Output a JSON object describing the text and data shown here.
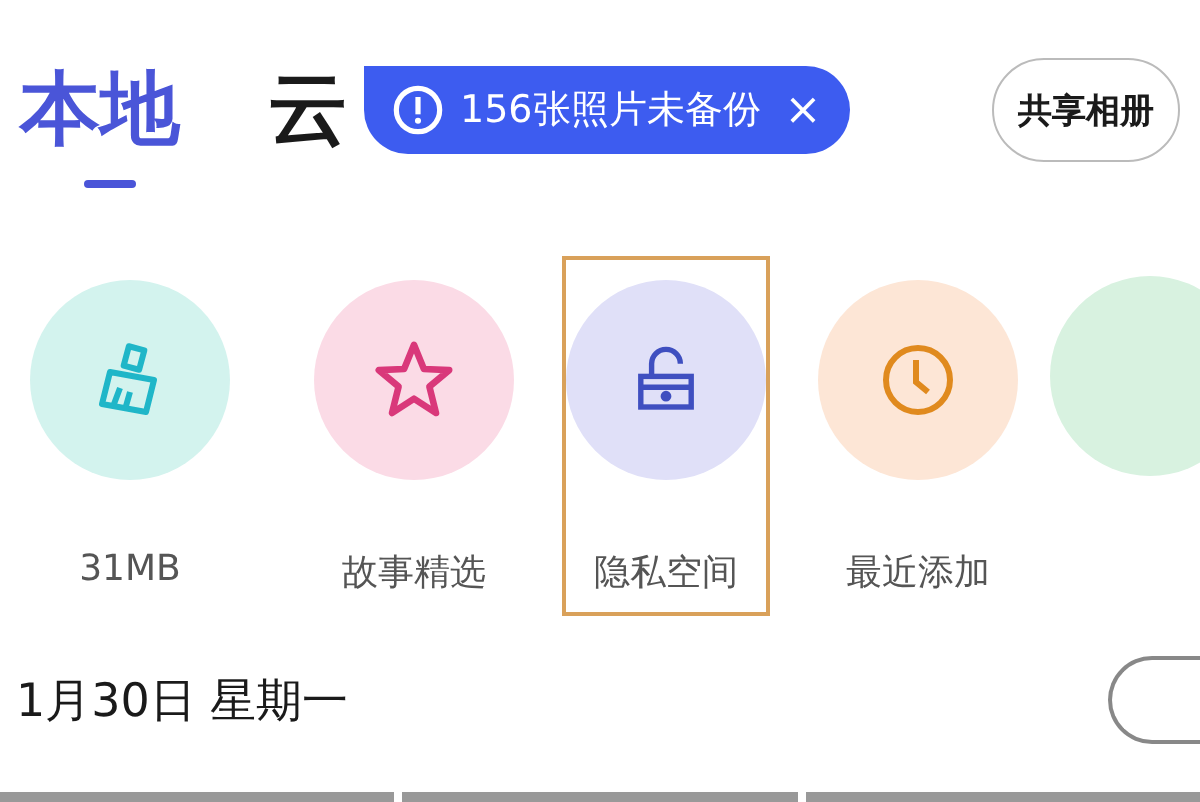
{
  "tabs": [
    {
      "label": "本地",
      "selected": true
    },
    {
      "label": "云",
      "selected": false
    }
  ],
  "backup_badge": {
    "text": "156张照片未备份",
    "close": "×"
  },
  "share_button": {
    "label": "共享相册"
  },
  "shortcuts": [
    {
      "kind": "clean",
      "label": "31MB",
      "color": "#d3f3ee",
      "highlighted": false
    },
    {
      "kind": "story",
      "label": "故事精选",
      "color": "#fbdbe6",
      "highlighted": false
    },
    {
      "kind": "private",
      "label": "隐私空间",
      "color": "#e0e0f8",
      "highlighted": true
    },
    {
      "kind": "recent",
      "label": "最近添加",
      "color": "#fde6d6",
      "highlighted": false
    }
  ],
  "date_header": {
    "text": "1月30日 星期一"
  }
}
